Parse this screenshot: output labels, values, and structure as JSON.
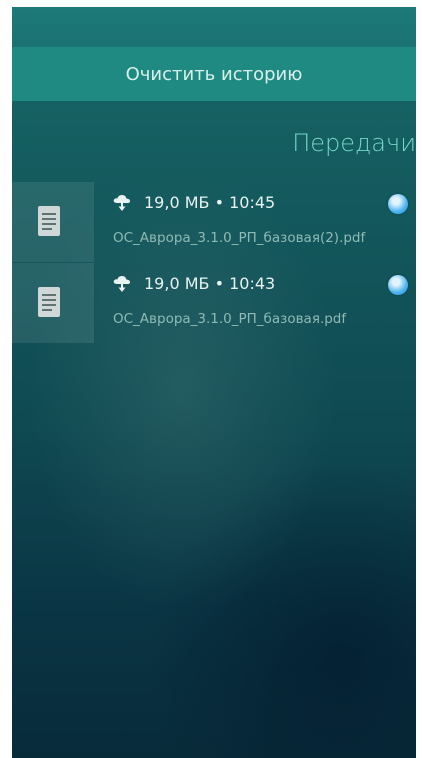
{
  "actions": {
    "clear_history_label": "Очистить историю"
  },
  "header": {
    "title": "Передачи"
  },
  "transfers": [
    {
      "meta": "19,0 МБ • 10:45",
      "filename": "ОС_Аврора_3.1.0_РП_базовая(2).pdf",
      "file_icon": "document-icon",
      "direction_icon": "cloud-download-icon",
      "status_icon": "globe-badge-icon"
    },
    {
      "meta": "19,0 МБ • 10:43",
      "filename": "ОС_Аврора_3.1.0_РП_базовая.pdf",
      "file_icon": "document-icon",
      "direction_icon": "cloud-download-icon",
      "status_icon": "globe-badge-icon"
    }
  ],
  "colors": {
    "accent": "#73d6c6",
    "button": "#1e8a82"
  }
}
